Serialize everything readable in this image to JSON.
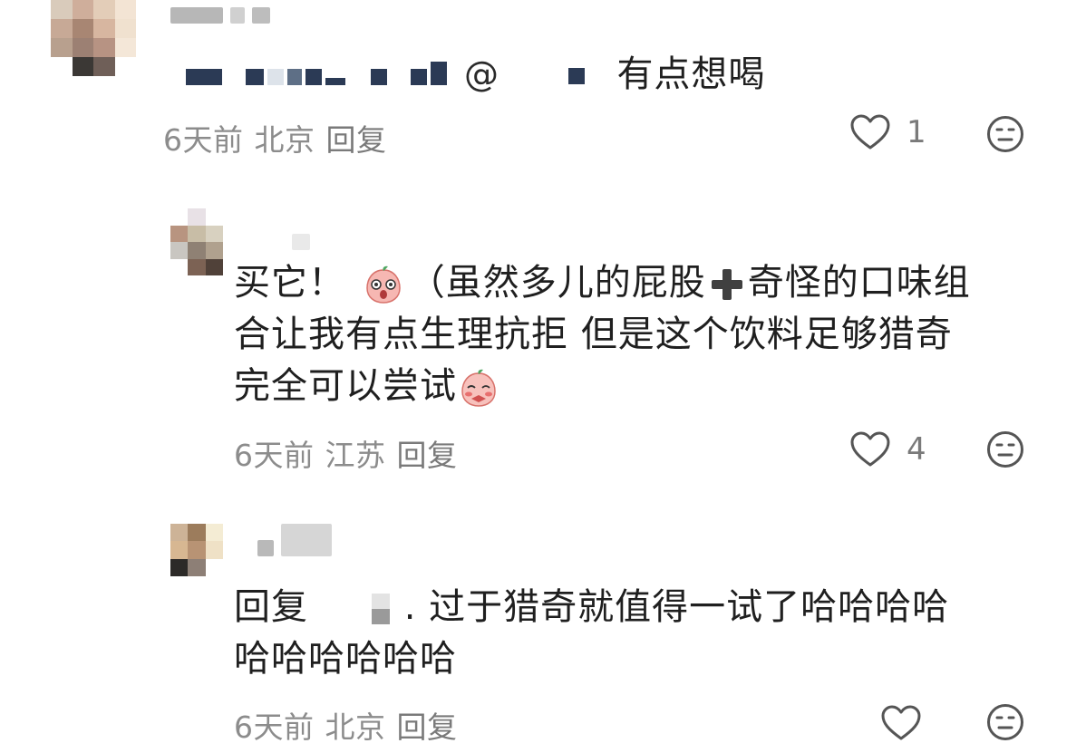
{
  "comments": [
    {
      "id": "c1",
      "mention_symbol": "@",
      "text": "有点想喝",
      "meta": {
        "time": "6天前",
        "location": "北京",
        "reply_label": "回复"
      },
      "like_count": "1"
    },
    {
      "id": "c2",
      "text_part1": "买它！",
      "text_part2": "（虽然多儿的屁股",
      "text_part3": "奇怪的口味组",
      "line2": "合让我有点生理抗拒 但是这个饮料足够猎奇",
      "line3": "完全可以尝试",
      "meta": {
        "time": "6天前",
        "location": "江苏",
        "reply_label": "回复"
      },
      "like_count": "4"
    },
    {
      "id": "c3",
      "reply_prefix": "回复",
      "text_line1": ". 过于猎奇就值得一试了哈哈哈哈",
      "text_line2": "哈哈哈哈哈哈",
      "meta": {
        "time": "6天前",
        "location": "北京",
        "reply_label": "回复"
      }
    }
  ],
  "icons": {
    "like": "heart-outline-icon",
    "dislike": "neutral-face-icon",
    "emoji1": "surprised-peach-emoji",
    "emoji2": "shy-peach-emoji",
    "plus": "heavy-plus-sign-icon"
  },
  "colors": {
    "meta_text": "#8c8c8c",
    "body_text": "#1f1f1f",
    "icon_stroke": "#555555"
  }
}
